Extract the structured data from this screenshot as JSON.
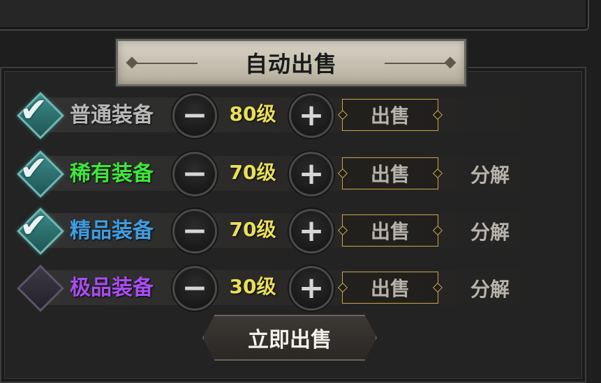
{
  "panel": {
    "title": "自动出售"
  },
  "rows": [
    {
      "checked": true,
      "category": "普通装备",
      "category_color": "#b8b8b8",
      "level": "80级",
      "sell_label": "出售",
      "dismantle_label": ""
    },
    {
      "checked": true,
      "category": "稀有装备",
      "category_color": "#3ee63a",
      "level": "70级",
      "sell_label": "出售",
      "dismantle_label": "分解"
    },
    {
      "checked": true,
      "category": "精品装备",
      "category_color": "#3f9de0",
      "level": "70级",
      "sell_label": "出售",
      "dismantle_label": "分解"
    },
    {
      "checked": false,
      "category": "极品装备",
      "category_color": "#a94df0",
      "level": "30级",
      "sell_label": "出售",
      "dismantle_label": "分解"
    }
  ],
  "icons": {
    "minus": "−",
    "plus": "+",
    "check": "✔"
  },
  "actions": {
    "sell_now_label": "立即出售"
  }
}
